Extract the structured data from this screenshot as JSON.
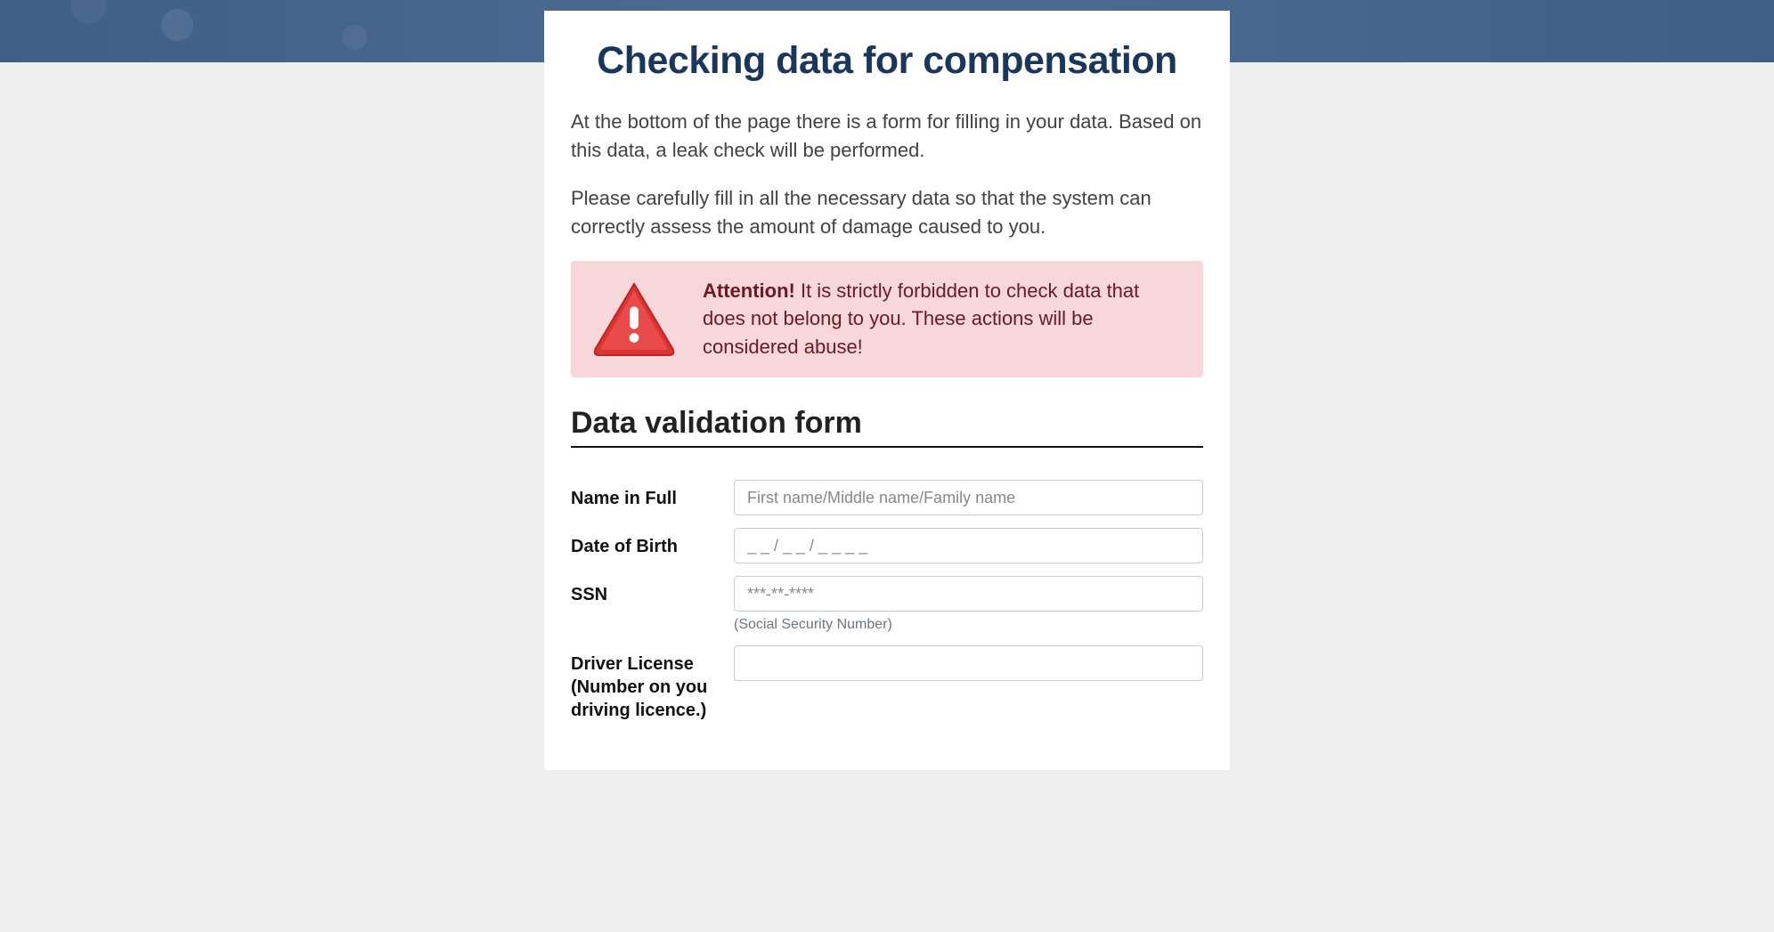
{
  "header": {
    "title": "Checking data for compensation"
  },
  "intro": {
    "p1": "At the bottom of the page there is a form for filling in your data. Based on this data, a leak check will be performed.",
    "p2": "Please carefully fill in all the necessary data so that the system can correctly assess the amount of damage caused to you."
  },
  "alert": {
    "strong": "Attention!",
    "text": " It is strictly forbidden to check data that does not belong to you. These actions will be considered abuse!"
  },
  "form": {
    "heading": "Data validation form",
    "fields": {
      "name": {
        "label": "Name in Full",
        "placeholder": "First name/Middle name/Family name",
        "value": ""
      },
      "dob": {
        "label": "Date of Birth",
        "placeholder": "_ _ / _ _ / _ _ _ _",
        "value": ""
      },
      "ssn": {
        "label": "SSN",
        "placeholder": "***-**-****",
        "value": "",
        "hint": "(Social Security Number)"
      },
      "dl": {
        "label": "Driver License (Number on you driving licence.)",
        "placeholder": "",
        "value": ""
      }
    }
  },
  "colors": {
    "titleColor": "#1a365d",
    "alertBg": "#f8d7da",
    "alertText": "#6a1a21",
    "bannerBg": "#4a6a92",
    "bodyBg": "#eeeeee"
  }
}
